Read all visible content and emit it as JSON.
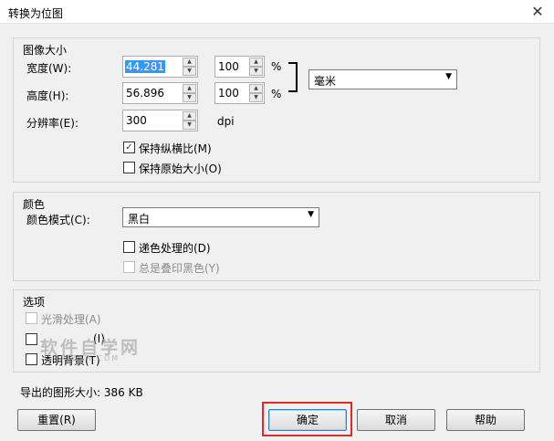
{
  "window": {
    "title": "转换为位图",
    "close": "✕"
  },
  "image_size": {
    "group_title": "图像大小",
    "width": {
      "label": "宽度(W):",
      "value": "44.281",
      "percent": "100",
      "percent_unit": "%"
    },
    "height": {
      "label": "高度(H):",
      "value": "56.896",
      "percent": "100",
      "percent_unit": "%"
    },
    "unit_select": "毫米",
    "resolution": {
      "label": "分辨率(E):",
      "value": "300",
      "unit": "dpi"
    },
    "keep_ratio": {
      "label": "保持纵横比(M)",
      "checked": true
    },
    "keep_original": {
      "label": "保持原始大小(O)",
      "checked": false
    }
  },
  "color": {
    "group_title": "颜色",
    "mode_label": "颜色模式(C):",
    "mode_value": "黑白",
    "dither": {
      "label": "递色处理的(D)",
      "checked": false
    },
    "overprint": {
      "label": "总是叠印黑色(Y)",
      "checked": false
    }
  },
  "options": {
    "group_title": "选项",
    "anti_alias": {
      "label": "光滑处理(A)"
    },
    "option2": {
      "label": "(I)"
    },
    "transparent": {
      "label": "透明背景(T)"
    }
  },
  "watermark": {
    "text": "软件自学网",
    "sub": "RJZXW.COM"
  },
  "export_size": "导出的图形大小: 386 KB",
  "buttons": {
    "reset": "重置(R)",
    "ok": "确定",
    "cancel": "取消",
    "help": "帮助"
  },
  "icons": {
    "spin_up": "▲",
    "spin_down": "▼",
    "caret": "▼",
    "check": "✓"
  }
}
